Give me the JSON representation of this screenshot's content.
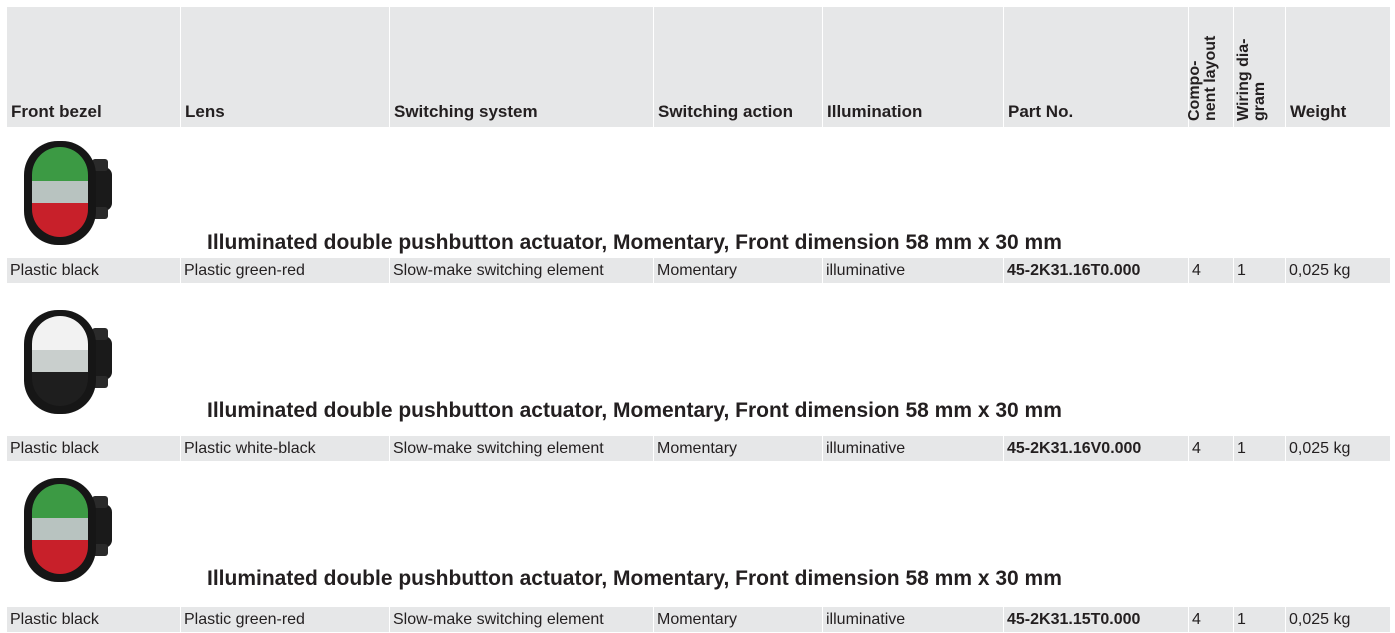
{
  "headers": {
    "front_bezel": "Front bezel",
    "lens": "Lens",
    "switching_system": "Switching system",
    "switching_action": "Switching action",
    "illumination": "Illumination",
    "part_no": "Part No.",
    "component_layout_line1": "Compo-",
    "component_layout_line2": "nent layout",
    "wiring_diagram_line1": "Wiring dia-",
    "wiring_diagram_line2": "gram",
    "weight": "Weight"
  },
  "colors": {
    "table_bg": "#e6e7e8",
    "text": "#231f20",
    "lens_green": "#3c9a44",
    "lens_red": "#c8202a",
    "lens_white": "#f2f2f2",
    "lens_black": "#1e1e1e"
  },
  "products": [
    {
      "image": "green-red-pushbutton",
      "title": "Illuminated double pushbutton actuator, Momentary, Front dimension 58 mm x 30 mm",
      "front_bezel": "Plastic black",
      "lens": "Plastic green-red",
      "switching_system": "Slow-make switching element",
      "switching_action": "Momentary",
      "illumination": "illuminative",
      "part_no": "45-2K31.16T0.000",
      "component_layout": "4",
      "wiring_diagram": "1",
      "weight": "0,025 kg"
    },
    {
      "image": "white-black-pushbutton",
      "title": "Illuminated double pushbutton actuator, Momentary, Front dimension 58 mm x 30 mm",
      "front_bezel": "Plastic black",
      "lens": "Plastic white-black",
      "switching_system": "Slow-make switching element",
      "switching_action": "Momentary",
      "illumination": "illuminative",
      "part_no": "45-2K31.16V0.000",
      "component_layout": "4",
      "wiring_diagram": "1",
      "weight": "0,025 kg"
    },
    {
      "image": "green-red-pushbutton",
      "title": "Illuminated double pushbutton actuator, Momentary, Front dimension 58 mm x 30 mm",
      "front_bezel": "Plastic black",
      "lens": "Plastic green-red",
      "switching_system": "Slow-make switching element",
      "switching_action": "Momentary",
      "illumination": "illuminative",
      "part_no": "45-2K31.15T0.000",
      "component_layout": "4",
      "wiring_diagram": "1",
      "weight": "0,025 kg"
    }
  ]
}
